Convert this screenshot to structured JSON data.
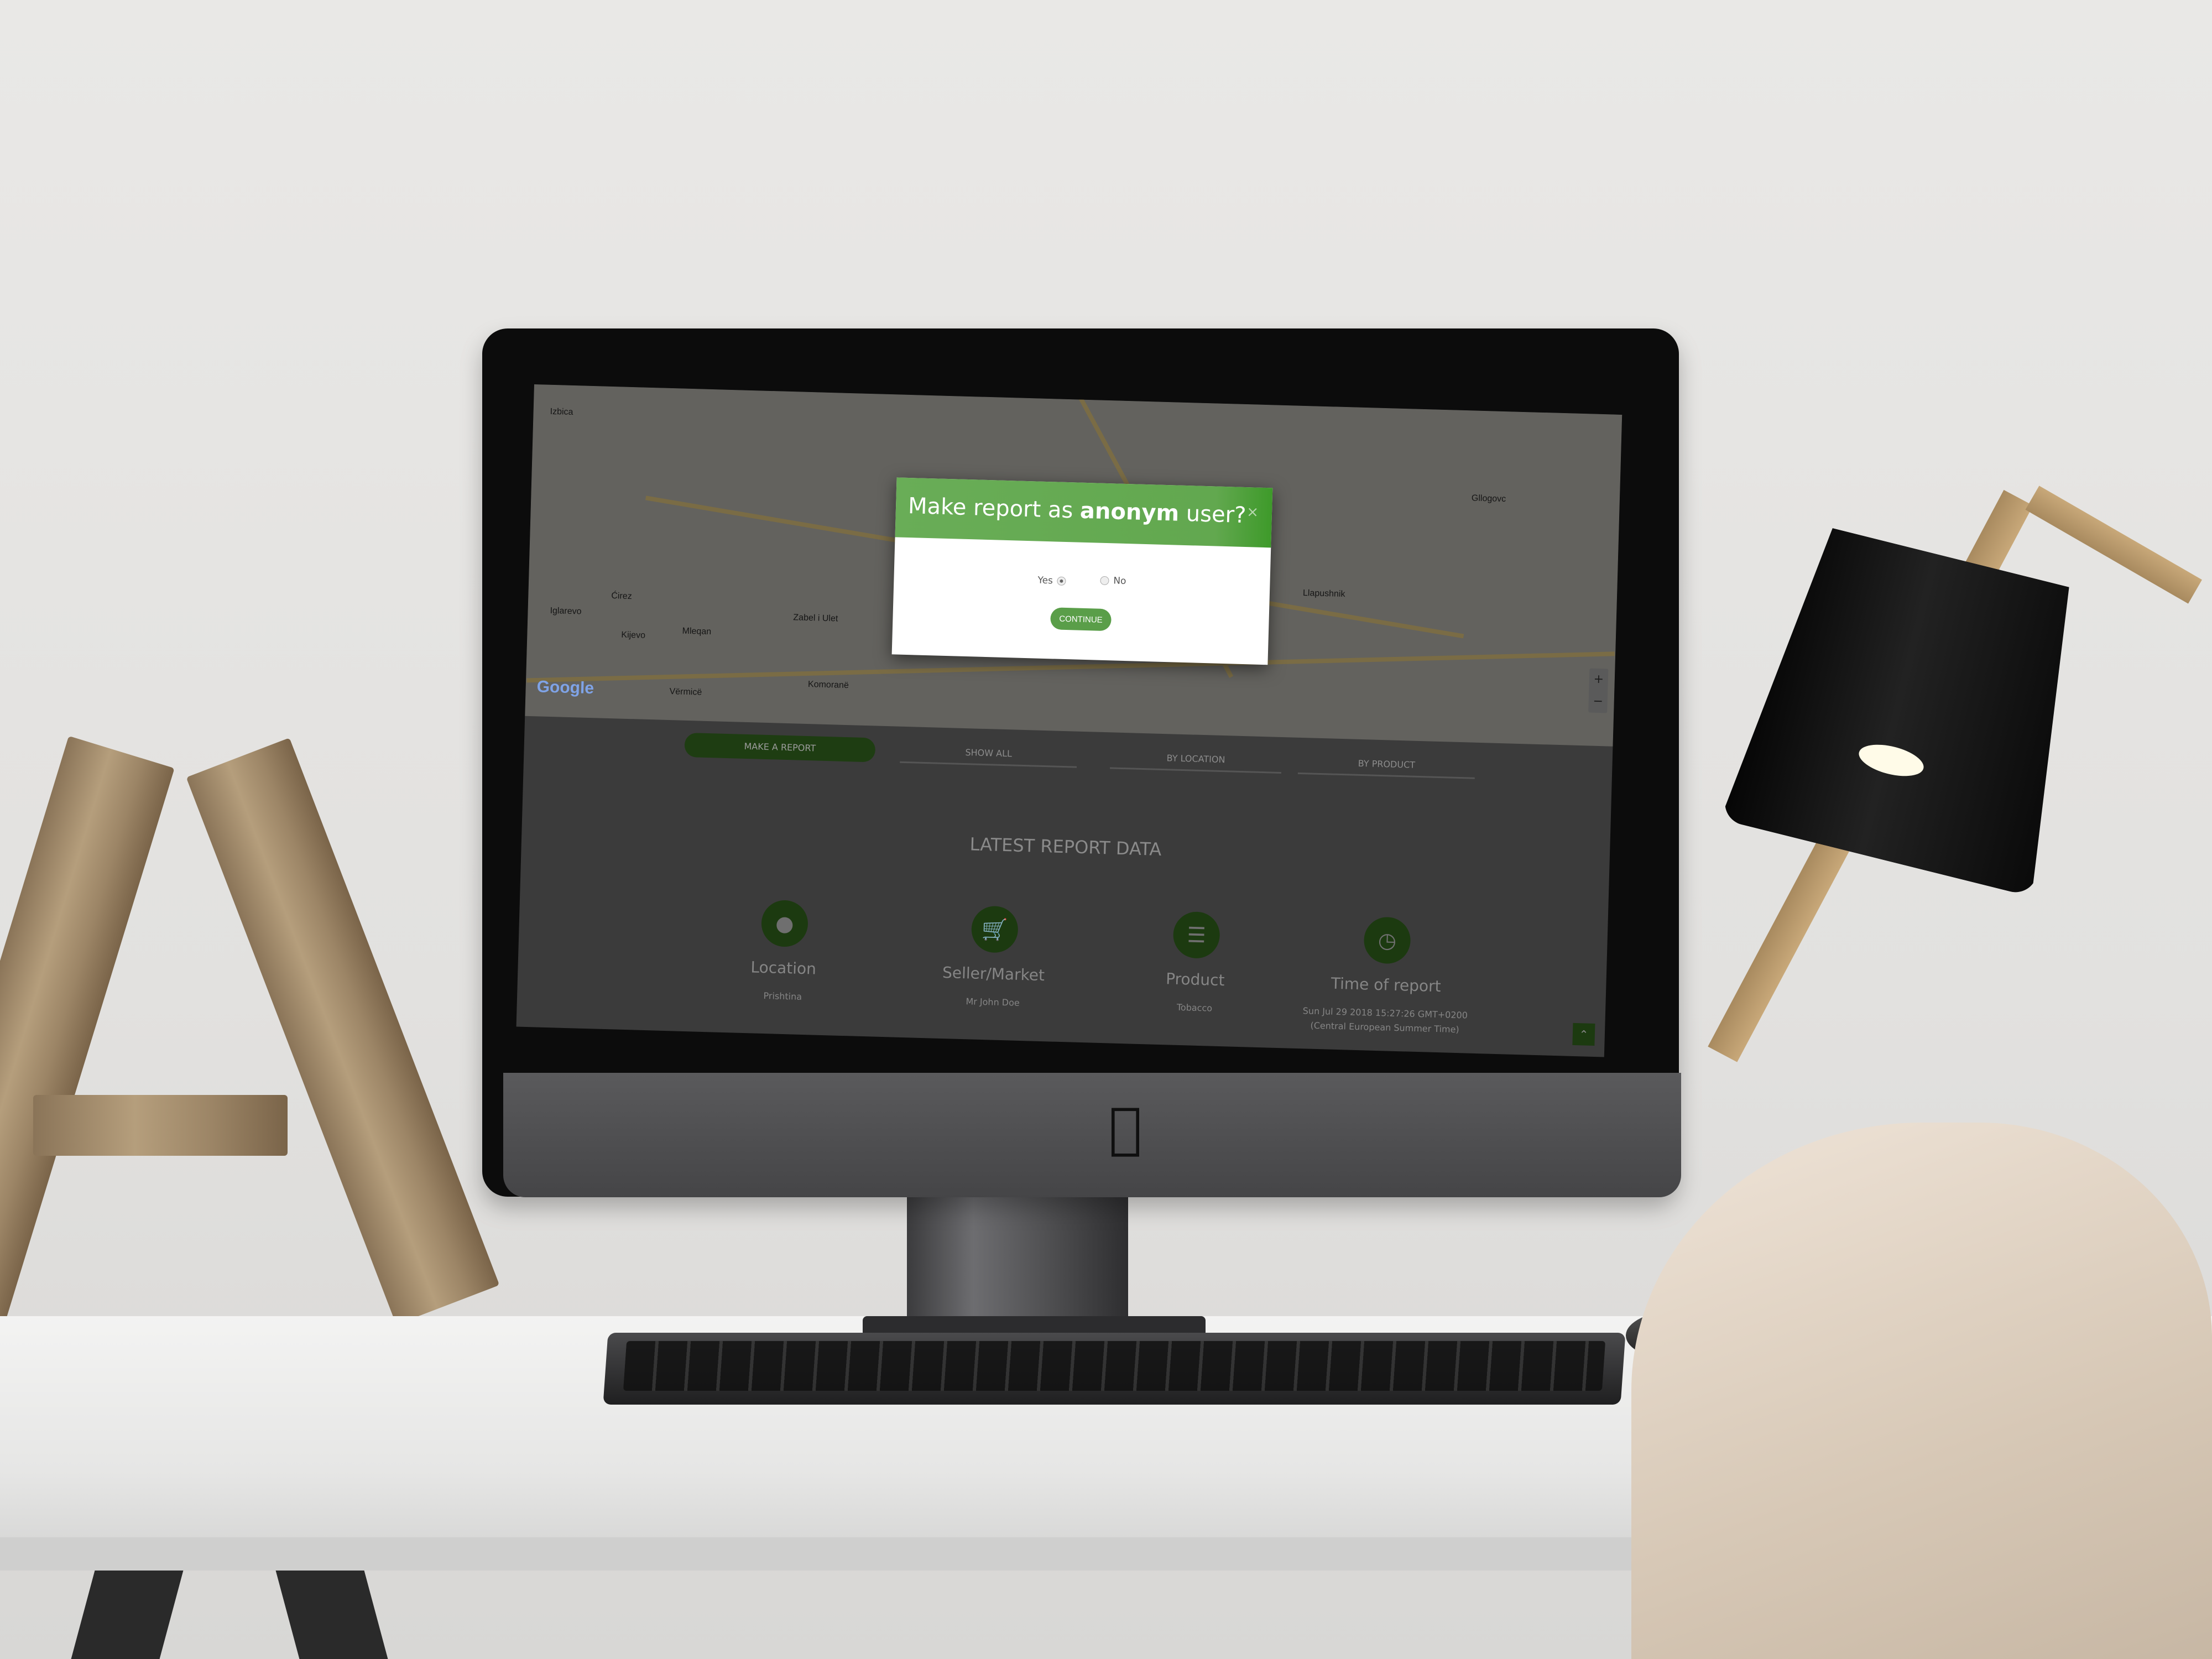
{
  "modal": {
    "title_pre": "Make report as",
    "title_bold": "anonym",
    "title_post": "user?",
    "close": "×",
    "options": [
      {
        "label": "Yes",
        "selected": true
      },
      {
        "label": "No",
        "selected": false
      }
    ],
    "continue_label": "CONTINUE"
  },
  "map": {
    "attribution": "Google",
    "labels": [
      "Izbica",
      "Iglarevo",
      "Ćirez",
      "Kijevo",
      "Mleqan",
      "Komoranë",
      "Zabel i Ulet",
      "Vërmicë",
      "Llapushnik",
      "Gllogovc"
    ],
    "zoom_in": "+",
    "zoom_out": "−"
  },
  "tabs": {
    "make_report": "MAKE A REPORT",
    "show_all": "SHOW ALL",
    "by_location": "BY LOCATION",
    "by_product": "BY PRODUCT"
  },
  "latest": {
    "title": "LATEST REPORT DATA",
    "columns": [
      {
        "icon": "map-pin-icon",
        "label": "Location",
        "value": "Prishtina"
      },
      {
        "icon": "cart-icon",
        "label": "Seller/Market",
        "value": "Mr John Doe"
      },
      {
        "icon": "list-icon",
        "label": "Product",
        "value": "Tobacco"
      },
      {
        "icon": "clock-icon",
        "label": "Time of report",
        "value": "Sun Jul 29 2018 15:27:26 GMT+0200",
        "value2": "(Central European Summer Time)"
      }
    ]
  },
  "colors": {
    "accent": "#4aa02c",
    "modal_header": "#69ad57"
  }
}
